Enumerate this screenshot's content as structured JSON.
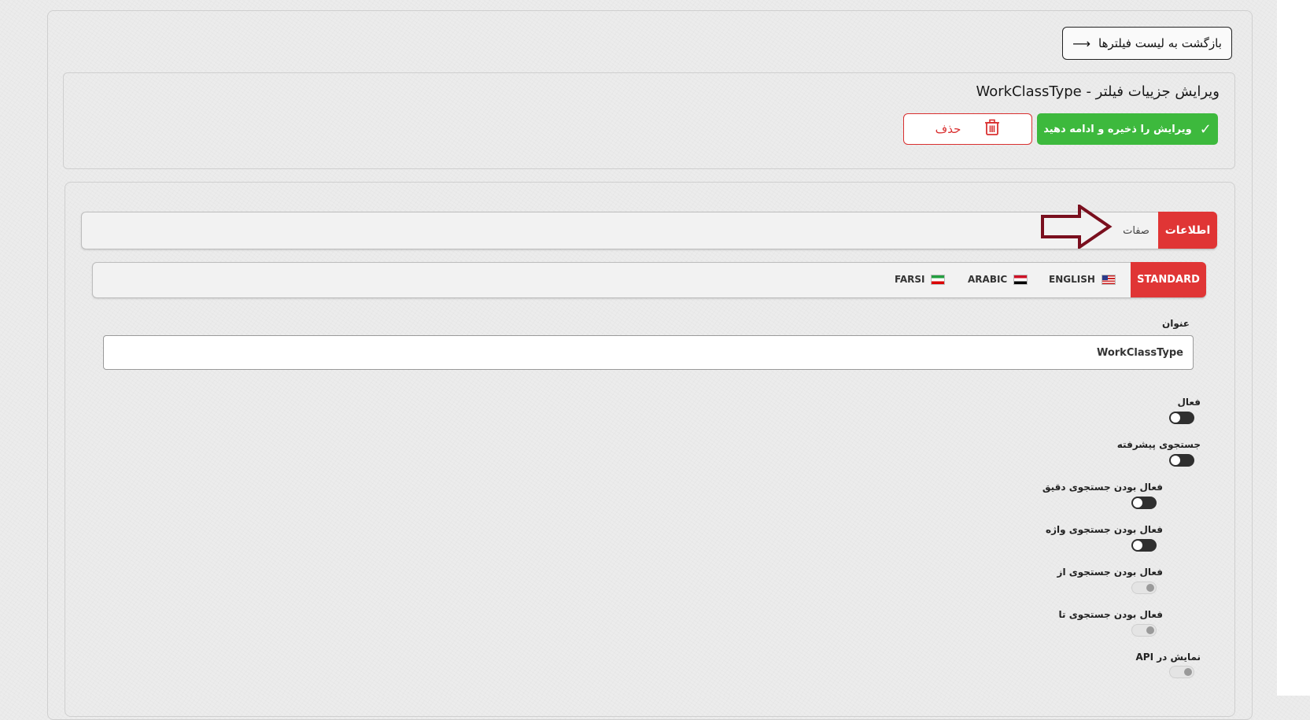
{
  "back_button": {
    "label": "بازگشت به لیست فیلترها",
    "icon": "arrow-right-icon"
  },
  "header": {
    "title": "ویرایش جزییات فیلتر - WorkClassType",
    "save_label": "ویرایش را ذخیره و ادامه دهید",
    "delete_label": "حذف"
  },
  "tabs": [
    {
      "label": "اطلاعات",
      "active": true
    },
    {
      "label": "صفات",
      "active": false
    }
  ],
  "lang_tabs": [
    {
      "label": "STANDARD",
      "active": true
    },
    {
      "label": "ENGLISH",
      "flag": "us-flag-icon"
    },
    {
      "label": "ARABIC",
      "flag": "iraq-flag-icon"
    },
    {
      "label": "FARSI",
      "flag": "iran-flag-icon"
    }
  ],
  "form": {
    "title_label": "عنوان",
    "title_value": "WorkClassType",
    "toggles": [
      {
        "label": "فعال",
        "state": "off"
      },
      {
        "label": "جستجوی پیشرفته",
        "state": "off"
      },
      {
        "label": "فعال بودن جستجوی دقیق",
        "state": "off"
      },
      {
        "label": "فعال بودن جستجوی واژه",
        "state": "off"
      },
      {
        "label": "فعال بودن جستجوی از",
        "state": "disabled"
      },
      {
        "label": "فعال بودن جستجوی تا",
        "state": "disabled"
      },
      {
        "label": "نمایش در API",
        "state": "disabled"
      }
    ]
  },
  "colors": {
    "accent_red": "#e03535",
    "success_green": "#3db93d",
    "annotation_arrow": "#7a0f1e"
  }
}
